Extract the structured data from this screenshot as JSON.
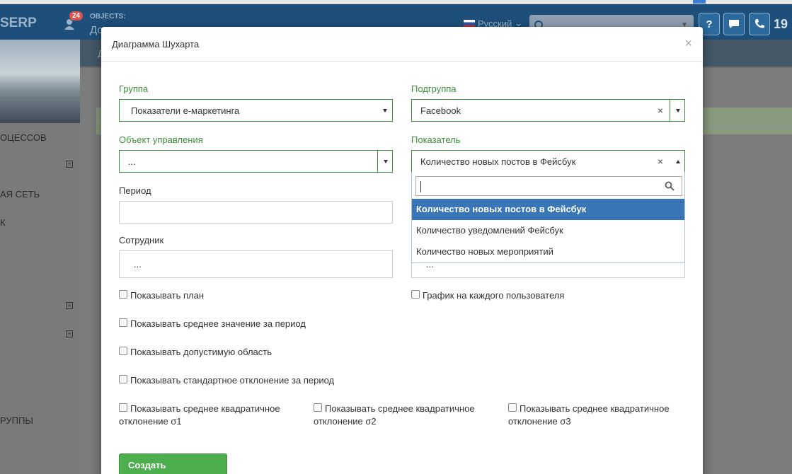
{
  "app": {
    "brand": "SERP",
    "notification_count": "24",
    "objects_label": "OBJECTS:",
    "objects_value": "До",
    "language": "Русский",
    "help_label": "?",
    "phone_number": "19",
    "top_title": "Д"
  },
  "sidebar": {
    "items": [
      "ОЦЕССОВ",
      "АЯ СЕТЬ",
      "К",
      "РУППЫ"
    ]
  },
  "modal": {
    "title": "Диаграмма Шухарта",
    "close": "×",
    "group_label": "Группа",
    "group_value": "Показатели е-маркетинга",
    "subgroup_label": "Подгруппа",
    "subgroup_value": "Facebook",
    "object_label": "Объект управления",
    "object_value": "...",
    "indicator_label": "Показатель",
    "indicator_value": "Количество новых постов в Фейсбук",
    "period_label": "Период",
    "period_value": "",
    "employee_label": "Сотрудник",
    "employee_value": "...",
    "right_hidden_value": "...",
    "clear_symbol": "×",
    "dropdown_options": [
      "Количество новых постов в Фейсбук",
      "Количество уведомлений Фейсбук",
      "Количество новых мероприятий"
    ],
    "checkboxes": {
      "show_plan": "Показывать план",
      "chart_per_user": "График на каждого пользователя",
      "show_average": "Показывать среднее значение за период",
      "show_allowed_area": "Показывать допустимую область",
      "show_std_dev": "Показывать стандартное отклонение за период",
      "sigma1_line1": "Показывать среднее квадратичное",
      "sigma1_line2": "отклонение σ1",
      "sigma2_line1": "Показывать среднее квадратичное",
      "sigma2_line2": "отклонение σ2",
      "sigma3_line1": "Показывать среднее квадратичное",
      "sigma3_line2": "отклонение σ3"
    },
    "create_button": "Создать диаграмму"
  },
  "colors": {
    "header_bg": "#1d4f7a",
    "label_green": "#3c8f3c",
    "option_active": "#3876b8",
    "button_green": "#4cae4c"
  }
}
